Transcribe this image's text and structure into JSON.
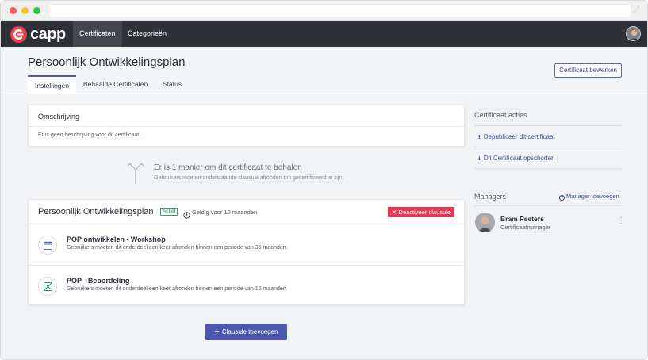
{
  "app": {
    "logo_text": "capp"
  },
  "nav": {
    "items": [
      {
        "label": "Certificaten"
      },
      {
        "label": "Categorieën"
      }
    ]
  },
  "page": {
    "title": "Persoonlijk Ontwikkelingsplan",
    "edit_label": "Certificaat bewerken",
    "tabs": [
      {
        "label": "Instellingen"
      },
      {
        "label": "Behaalde Certificaten"
      },
      {
        "label": "Status"
      }
    ]
  },
  "description": {
    "title": "Omschrijving",
    "text": "Er is geen beschrijving voor dit certificaat."
  },
  "ways": {
    "title": "Er is 1 manier om dit certificaat te behalen",
    "subtitle": "Gebruikers moeten onderstaande clausule afronden om gecertificeerd te zijn."
  },
  "clause": {
    "title": "Persoonlijk Ontwikkelingsplan",
    "badge": "Actief",
    "valid": "Geldig voor 12 maanden",
    "deactivate_label": "Deactiveer clausule",
    "items": [
      {
        "title": "POP ontwikkelen - Workshop",
        "subtitle": "Gebruikers moeten dit onderdeel een keer afronden binnen een periode van 36 maanden.",
        "icon": "calendar-icon"
      },
      {
        "title": "POP - Beoordeling",
        "subtitle": "Gebruikers moeten dit onderdeel een keer afronden binnen een periode van 12 maanden.",
        "icon": "assessment-icon"
      }
    ]
  },
  "add_clause_label": "Clausule toevoegen",
  "actions": {
    "heading": "Certificaat acties",
    "items": [
      {
        "label": "Depubliceer dit certificaat"
      },
      {
        "label": "Dit Certificaat opschorten"
      }
    ]
  },
  "managers": {
    "heading": "Managers",
    "add_label": "Manager toevoegen",
    "list": [
      {
        "name": "Bram Peeters",
        "role": "Certificaatmanager"
      }
    ]
  },
  "colors": {
    "accent": "#4d57ab",
    "danger": "#e23a55",
    "success": "#36a26b",
    "nav_bg": "#2f3136",
    "brand": "#e8424e"
  }
}
